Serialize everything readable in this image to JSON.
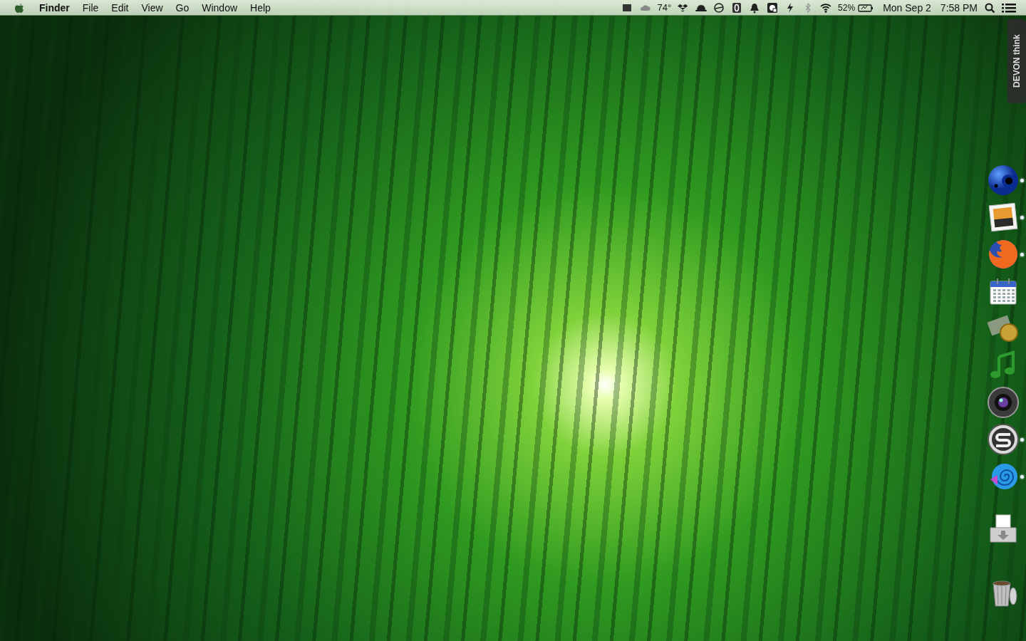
{
  "menu_bar": {
    "app_name": "Finder",
    "menus": [
      "File",
      "Edit",
      "View",
      "Go",
      "Window",
      "Help"
    ],
    "weather": "74°",
    "battery": "52%",
    "date": "Mon Sep 2",
    "time": "7:58 PM"
  },
  "side_tab": {
    "label": "DEVON think"
  },
  "dock": {
    "items": [
      {
        "running": true
      },
      {
        "running": true
      },
      {
        "running": true
      },
      {
        "running": false
      },
      {
        "running": false
      },
      {
        "running": false
      },
      {
        "running": false
      },
      {
        "running": true
      },
      {
        "running": true
      },
      {
        "running": false
      },
      {
        "running": false
      }
    ]
  }
}
